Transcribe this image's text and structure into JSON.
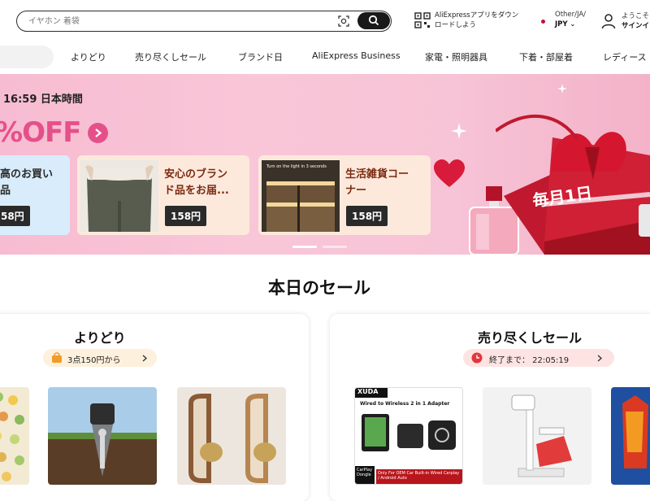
{
  "header": {
    "search_placeholder": "イヤホン 着袋",
    "app_promo_line1": "AliExpressアプリをダウン",
    "app_promo_line2": "ロードしよう",
    "region_top": "Other/JA/",
    "region_currency": "JPY",
    "welcome": "ようこそ",
    "signin": "サインイ"
  },
  "nav": {
    "items": [
      "よりどり",
      "売り尽くしセール",
      "ブランド日",
      "AliExpress Business",
      "家電・照明器具",
      "下着・部屋着",
      "レディース"
    ]
  },
  "banner": {
    "time": "16:59 日本時間",
    "headline": "%OFF",
    "cards": [
      {
        "title_line1": "高のお買い",
        "title_line2": "品",
        "price": "58円"
      },
      {
        "title_line1": "安心のブラン",
        "title_line2": "ド品をお届...",
        "price": "158円"
      },
      {
        "title_line1": "生活雑貨コー",
        "title_line2": "ナー",
        "price": "158円"
      }
    ],
    "photo_caption": "Turn on the light in 3 seconds",
    "gift_tag": "毎月1日"
  },
  "section_title": "本日のセール",
  "panels": [
    {
      "title": "よりどり",
      "badge": "3点150円から"
    },
    {
      "title": "売り尽くしセール",
      "badge": "終了まで： 22:05:19"
    }
  ],
  "product_text": {
    "xuda_brand": "XUDA",
    "xuda_title": "Wired to Wireless 2 in 1 Adapter",
    "xuda_bottom": "Only For OEM Car Built-in Wired Carplay / Android Auto",
    "xuda_logo": "CarPlay Dongle"
  },
  "colors": {
    "accent_pink": "#e5508a",
    "banner_bg": "#f9c6d8",
    "price_tag": "#2a2a2a",
    "search_button": "#191919",
    "badge_bg": "#fdf0dc",
    "timer_red": "#e0383e"
  }
}
